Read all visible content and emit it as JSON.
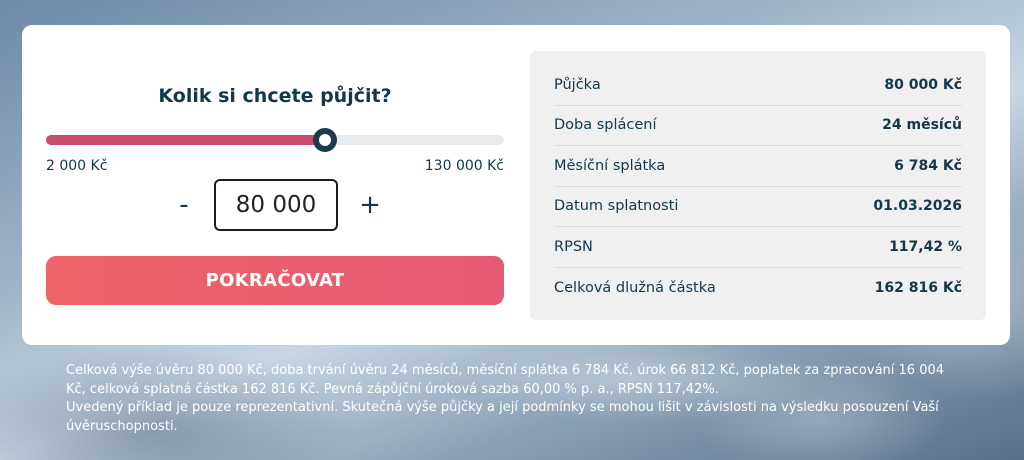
{
  "calculator": {
    "question": "Kolik si chcete půjčit?",
    "slider": {
      "min_label": "2 000 Kč",
      "max_label": "130 000 Kč",
      "min": 2000,
      "max": 130000,
      "value": 80000,
      "fill_color": "#c94b6d",
      "track_color": "#e9ecee",
      "thumb_color": "#1b3c4c"
    },
    "stepper": {
      "minus_label": "-",
      "plus_label": "+",
      "value": "80 000"
    },
    "cta_label": "POKRAČOVAT",
    "cta_color": "#ef6469"
  },
  "summary": {
    "rows": [
      {
        "label": "Půjčka",
        "value": "80 000 Kč"
      },
      {
        "label": "Doba splácení",
        "value": "24 měsíců"
      },
      {
        "label": "Měsíční splátka",
        "value": "6 784 Kč"
      },
      {
        "label": "Datum splatnosti",
        "value": "01.03.2026"
      },
      {
        "label": "RPSN",
        "value": "117,42 %"
      },
      {
        "label": "Celková dlužná částka",
        "value": "162 816 Kč"
      }
    ]
  },
  "disclaimer": {
    "line1": "Celková výše úvěru 80 000 Kč, doba trvání úvěru 24 měsíců, měsíční splátka 6 784 Kč, úrok 66 812 Kč, poplatek za zpracování 16 004 Kč, celková splatná částka 162 816 Kč. Pevná zápůjční úroková sazba 60,00 % p. a., RPSN 117,42%.",
    "line2": "Uvedený příklad je pouze reprezentativní. Skutečná výše půjčky a její podmínky se mohou lišit v závislosti na výsledku posouzení Vaší úvěruschopnosti."
  },
  "theme": {
    "text_primary": "#12384a",
    "card_background": "#ffffff",
    "summary_background": "#f0f0f0"
  }
}
